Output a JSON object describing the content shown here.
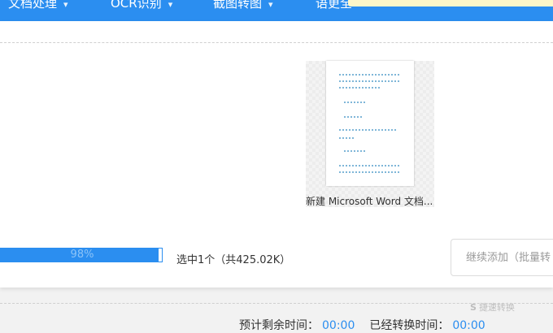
{
  "nav": {
    "items": [
      {
        "label": "文档处理"
      },
      {
        "label": "OCR识别"
      },
      {
        "label": "截图转图"
      },
      {
        "label": "语更全"
      }
    ]
  },
  "file": {
    "name": "新建 Microsoft Word 文档..."
  },
  "progress": {
    "percent": 98,
    "label": "98%"
  },
  "selection": {
    "summary": "选中1个（共425.02K）"
  },
  "add_more": {
    "placeholder": "继续添加（批量转"
  },
  "watermark": {
    "logo": "S",
    "text": "捷速转换"
  },
  "time": {
    "remaining_label": "预计剩余时间：",
    "remaining_value": "00:00",
    "elapsed_label": "已经转换时间：",
    "elapsed_value": "00:00"
  },
  "colors": {
    "accent": "#2b8ef0",
    "banner": "#fdf7c9"
  }
}
